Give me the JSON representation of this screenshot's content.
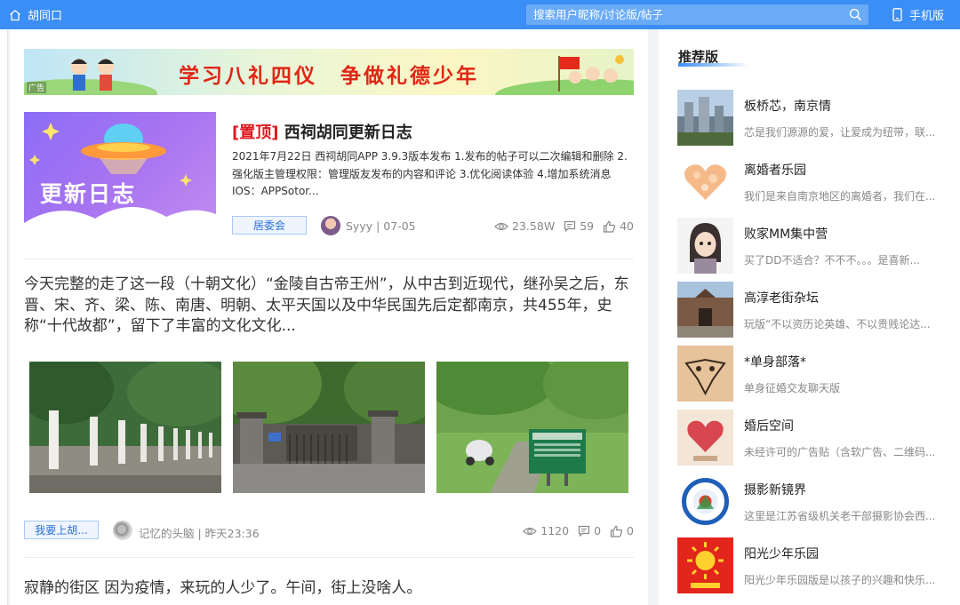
{
  "header": {
    "site_name": "胡同口",
    "search_placeholder": "搜索用户昵称/讨论版/帖子",
    "mobile_label": "手机版"
  },
  "banner": {
    "text": "学习八礼四仪　争做礼德少年",
    "ad_label": "广告"
  },
  "posts": [
    {
      "pin_label": "[置顶]",
      "title": "西祠胡同更新日志",
      "thumb_text": "更新日志",
      "excerpt": "2021年7月22日 西祠胡同APP 3.9.3版本发布 1.发布的帖子可以二次编辑和删除 2.强化版主管理权限：管理版友发布的内容和评论 3.优化阅读体验 4.增加系统消息 IOS：APPSotor...",
      "board": "居委会",
      "author": "Syyy",
      "time": "| 07-05",
      "views": "23.58W",
      "comments": "59",
      "likes": "40"
    },
    {
      "text": "今天完整的走了这一段（十朝文化）“金陵自古帝王州”，从中古到近现代，继孙吴之后，东晋、宋、齐、梁、陈、南唐、明朝、太平天国以及中华民国先后定都南京，共455年，史称“十代故都”，留下了丰富的文化文化...",
      "board": "我要上胡...",
      "author": "记忆的头脑",
      "time": "| 昨天23:36",
      "views": "1120",
      "comments": "0",
      "likes": "0"
    },
    {
      "text": "寂静的街区 因为疫情，来玩的人少了。午间，街上没啥人。"
    }
  ],
  "sidebar": {
    "title": "推荐版",
    "boards": [
      {
        "name": "板桥芯，南京情",
        "desc": "芯是我们源源的爱，让爱成为纽带，联..."
      },
      {
        "name": "离婚者乐园",
        "desc": "我们是来自南京地区的离婚者，我们在..."
      },
      {
        "name": "败家MM集中营",
        "desc": "买了DD不适合？不不不。。。是喜新..."
      },
      {
        "name": "高淳老街杂坛",
        "desc": "玩版“不以资历论英雄、不以贵贱论达..."
      },
      {
        "name": "*单身部落*",
        "desc": "单身征婚交友聊天版"
      },
      {
        "name": "婚后空间",
        "desc": "未经许可的广告贴（含软广告、二维码..."
      },
      {
        "name": "摄影新镜界",
        "desc": "这里是江苏省级机关老干部摄影协会西..."
      },
      {
        "name": "阳光少年乐园",
        "desc": "阳光少年乐园版是以孩子的兴趣和快乐..."
      }
    ]
  },
  "colors": {
    "header_bg": "#3a8ef6",
    "pin_red": "#e0191f",
    "tag_blue": "#2c6fd8"
  }
}
